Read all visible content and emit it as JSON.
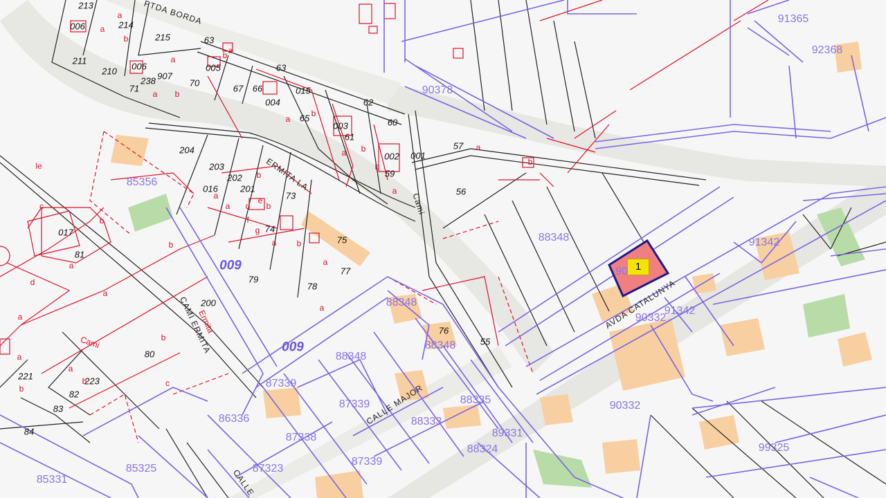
{
  "map": {
    "colors": {
      "background": "#f6f6f6",
      "road": "#e6e6e2",
      "parcel_blue": "#7a63e6",
      "parcel_red": "#e0102a",
      "building": "#f7cfa0",
      "green": "#b8dca8",
      "highlight": "#f08080"
    },
    "selected_marker": "1",
    "streets": {
      "ptda_borda": "PTDA BORDA",
      "ermita": "ERMITA LA",
      "cami": "Cami",
      "cami_ermita": "CAMI ERMITA",
      "ermita_red": "Ermita",
      "calle_major": "CALLE MAJOR",
      "avda_catalunya": "AVDA CATALUNYA",
      "calle": "CALLE"
    },
    "blue_labels": {
      "p91365": "91365",
      "p92368": "92368",
      "p90378": "90378",
      "p85356": "85356",
      "p88348a": "88348",
      "p91342a": "91342",
      "p009a": "009",
      "p88348b": "88348",
      "p90332a": "90332",
      "p91342b": "91342",
      "p90sel": "90",
      "p009b": "009",
      "p88348c": "88348",
      "p88348d": "88348",
      "p87339a": "87339",
      "p87339b": "87339",
      "p88335": "88335",
      "p86336": "86336",
      "p88333": "88333",
      "p87338": "87338",
      "p89331": "89331",
      "p88324": "88324",
      "p87339c": "87339",
      "p87323": "87323",
      "p90332b": "90332",
      "p99325": "99325",
      "p85325": "85325",
      "p85331": "85331"
    },
    "black_labels": {
      "n213": "213",
      "n214": "214",
      "n215": "215",
      "n006a": "006",
      "n211": "211",
      "n210": "210",
      "n006b": "006",
      "n907": "907",
      "n005": "005",
      "n63a": "63",
      "n63b": "63",
      "n71": "71",
      "n238": "238",
      "n70": "70",
      "n67": "67",
      "n66": "66",
      "n015": "015",
      "n004": "004",
      "n65": "65",
      "n62": "62",
      "n60": "60",
      "n003": "003",
      "n61": "61",
      "n002": "002",
      "n001": "001",
      "n59": "59",
      "n57": "57",
      "n56": "56",
      "n204": "204",
      "n203": "203",
      "n202": "202",
      "n016": "016",
      "n201": "201",
      "n73": "73",
      "n017": "017",
      "n81": "81",
      "n74": "74",
      "n75": "75",
      "n79": "79",
      "n78": "78",
      "n77": "77",
      "n200": "200",
      "n76": "76",
      "n80": "80",
      "n55": "55",
      "n221": "221",
      "n223": "223",
      "n82": "82",
      "n83": "83",
      "n84": "84"
    },
    "red_letters": {
      "a": "a",
      "b": "b",
      "c": "c",
      "d": "d",
      "e": "e",
      "f": "f",
      "g": "g",
      "le": "le"
    }
  }
}
